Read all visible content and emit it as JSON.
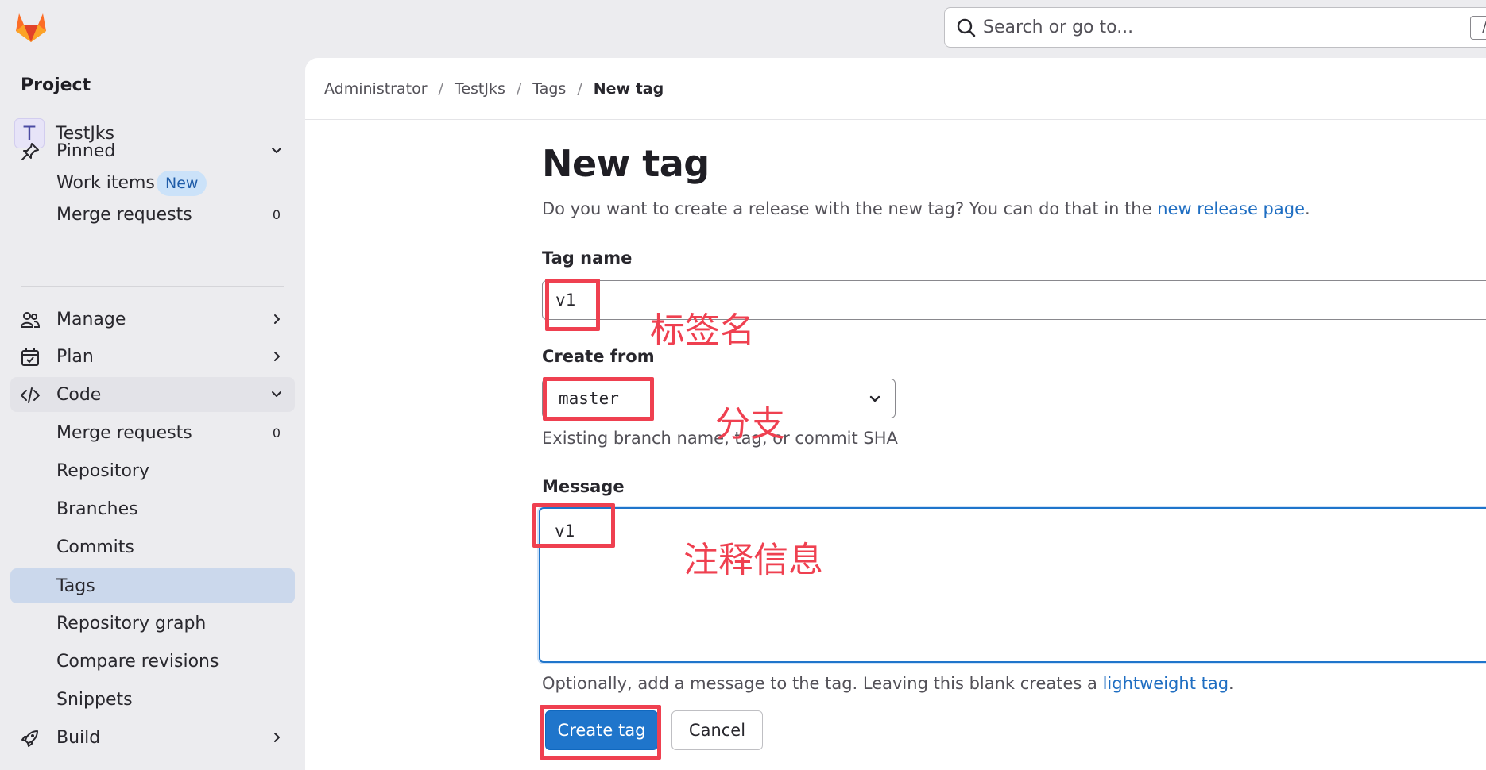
{
  "search": {
    "placeholder": "Search or go to...",
    "shortcut": "/"
  },
  "sidebar": {
    "heading": "Project",
    "project": {
      "avatar_letter": "T",
      "name": "TestJks"
    },
    "pinned": {
      "label": "Pinned",
      "items": [
        {
          "label": "Work items",
          "badge": "New"
        },
        {
          "label": "Merge requests",
          "count": "0"
        }
      ]
    },
    "sections": {
      "manage": "Manage",
      "plan": "Plan",
      "code": "Code",
      "build": "Build"
    },
    "code_items": [
      {
        "label": "Merge requests",
        "count": "0"
      },
      {
        "label": "Repository"
      },
      {
        "label": "Branches"
      },
      {
        "label": "Commits"
      },
      {
        "label": "Tags",
        "active": true
      },
      {
        "label": "Repository graph"
      },
      {
        "label": "Compare revisions"
      },
      {
        "label": "Snippets"
      }
    ]
  },
  "breadcrumb": [
    "Administrator",
    "TestJks",
    "Tags",
    "New tag"
  ],
  "page": {
    "title": "New tag",
    "intro_text": "Do you want to create a release with the new tag? You can do that in the ",
    "intro_link": "new release page",
    "intro_end": "."
  },
  "form": {
    "tag_name_label": "Tag name",
    "tag_name_value": "v1",
    "create_from_label": "Create from",
    "create_from_value": "master",
    "create_from_help": "Existing branch name, tag, or commit SHA",
    "message_label": "Message",
    "message_value": "v1",
    "message_help_text": "Optionally, add a message to the tag. Leaving this blank creates a ",
    "message_help_link": "lightweight tag",
    "message_help_end": ".",
    "create_button": "Create tag",
    "cancel_button": "Cancel"
  },
  "annotations": {
    "tag_name": "标签名",
    "branch": "分支",
    "message": "注释信息"
  },
  "colors": {
    "accent": "#1f75cb",
    "annotation_red": "#ef4050",
    "sidebar_active": "#cbd8ec"
  }
}
